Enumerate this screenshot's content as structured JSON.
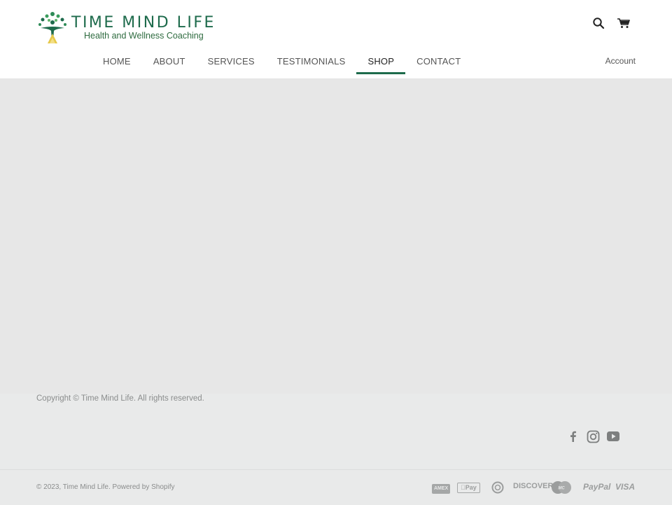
{
  "header": {
    "logo_title": "TIME MIND LIFE",
    "logo_subtitle": "Health and Wellness Coaching",
    "search_icon": "search-icon",
    "cart_icon": "cart-icon",
    "account_label": "Account"
  },
  "nav": {
    "items": [
      {
        "label": "HOME"
      },
      {
        "label": "ABOUT"
      },
      {
        "label": "SERVICES"
      },
      {
        "label": "TESTIMONIALS"
      },
      {
        "label": "SHOP"
      },
      {
        "label": "CONTACT"
      }
    ],
    "active": "SHOP"
  },
  "footer": {
    "copyright_top": "Copyright © Time Mind Life. All rights reserved.",
    "social_icons": [
      "facebook-icon",
      "instagram-icon",
      "youtube-icon"
    ],
    "copyright_bottom": "© 2023, Time Mind Life. Powered by Shopify",
    "payments": {
      "amex": "AMEX",
      "applepay": "Pay",
      "discover": "DISCOVER",
      "mastercard": "MC",
      "paypal": "PayPal",
      "visa": "VISA"
    }
  },
  "colors": {
    "brand": "#1e6b4c",
    "main_bg": "#e7e7e7",
    "footer_bg": "#e9eaea"
  }
}
